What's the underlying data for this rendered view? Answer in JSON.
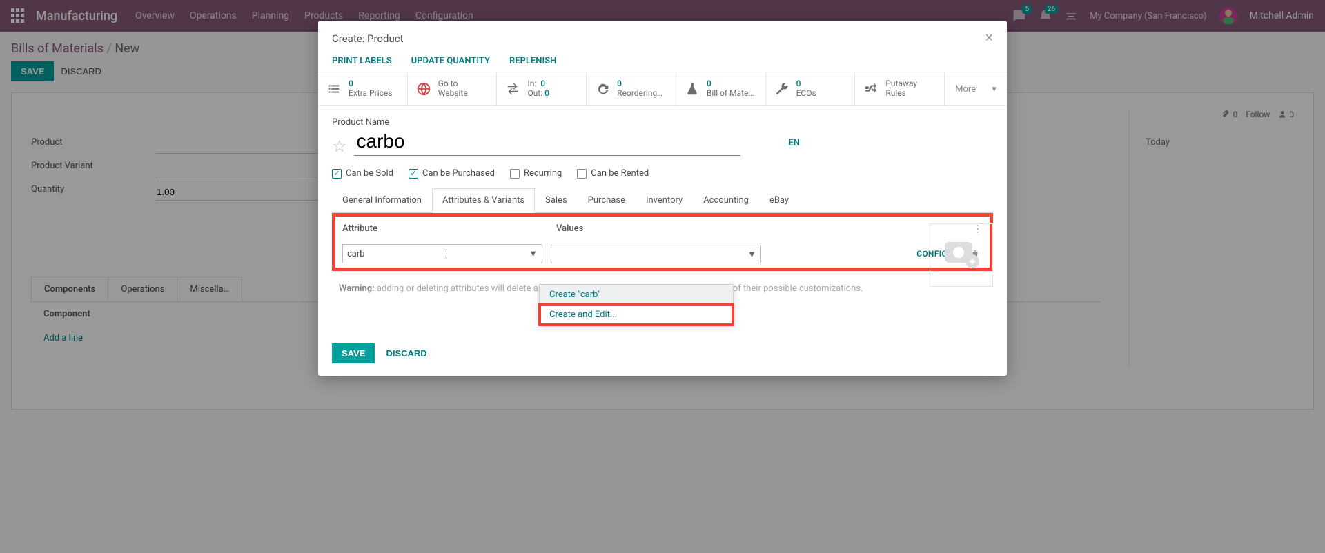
{
  "topnav": {
    "brand": "Manufacturing",
    "menu": [
      "Overview",
      "Operations",
      "Planning",
      "Products",
      "Reporting",
      "Configuration"
    ],
    "badge1": "5",
    "badge2": "26",
    "company": "My Company (San Francisco)",
    "user": "Mitchell Admin"
  },
  "breadcrumb": {
    "root": "Bills of Materials",
    "current": "New"
  },
  "actions": {
    "save": "SAVE",
    "discard": "DISCARD"
  },
  "sheet": {
    "labels": {
      "product": "Product",
      "variant": "Product Variant",
      "qty": "Quantity"
    },
    "qty_value": "1.00",
    "tabs": [
      "Components",
      "Operations",
      "Miscella…"
    ],
    "colhdr": "Component",
    "addline": "Add a line",
    "attach_count": "0",
    "follow": "Follow",
    "follower_count": "0",
    "today": "Today"
  },
  "modal": {
    "title": "Create: Product",
    "actions": [
      "PRINT LABELS",
      "UPDATE QUANTITY",
      "REPLENISH"
    ],
    "stats": {
      "extra_prices": {
        "num": "0",
        "label": "Extra Prices"
      },
      "website": {
        "l1": "Go to",
        "l2": "Website"
      },
      "inout": {
        "l1": "In:",
        "n1": "0",
        "l2": "Out:",
        "n2": "0"
      },
      "reorder": {
        "num": "0",
        "label": "Reordering…"
      },
      "bom": {
        "num": "0",
        "label": "Bill of Mate…"
      },
      "ecos": {
        "num": "0",
        "label": "ECOs"
      },
      "putaway": {
        "l1": "Putaway",
        "l2": "Rules"
      },
      "more": "More"
    },
    "pname_label": "Product Name",
    "pname_value": "carbo",
    "lang": "EN",
    "checks": {
      "sold": "Can be Sold",
      "purchased": "Can be Purchased",
      "recurring": "Recurring",
      "rented": "Can be Rented"
    },
    "ptabs": [
      "General Information",
      "Attributes & Variants",
      "Sales",
      "Purchase",
      "Inventory",
      "Accounting",
      "eBay"
    ],
    "attr": {
      "hdr_attr": "Attribute",
      "hdr_vals": "Values",
      "inp_val": "carb",
      "configure": "CONFIGURE"
    },
    "dropdown": {
      "create": "Create \"carb\"",
      "create_edit": "Create and Edit..."
    },
    "warning_label": "Warning:",
    "warning_text": " adding or deleting attributes will delete and recreate existing variants and lead to the loss of their possible customizations.",
    "footer": {
      "save": "SAVE",
      "discard": "DISCARD"
    }
  }
}
